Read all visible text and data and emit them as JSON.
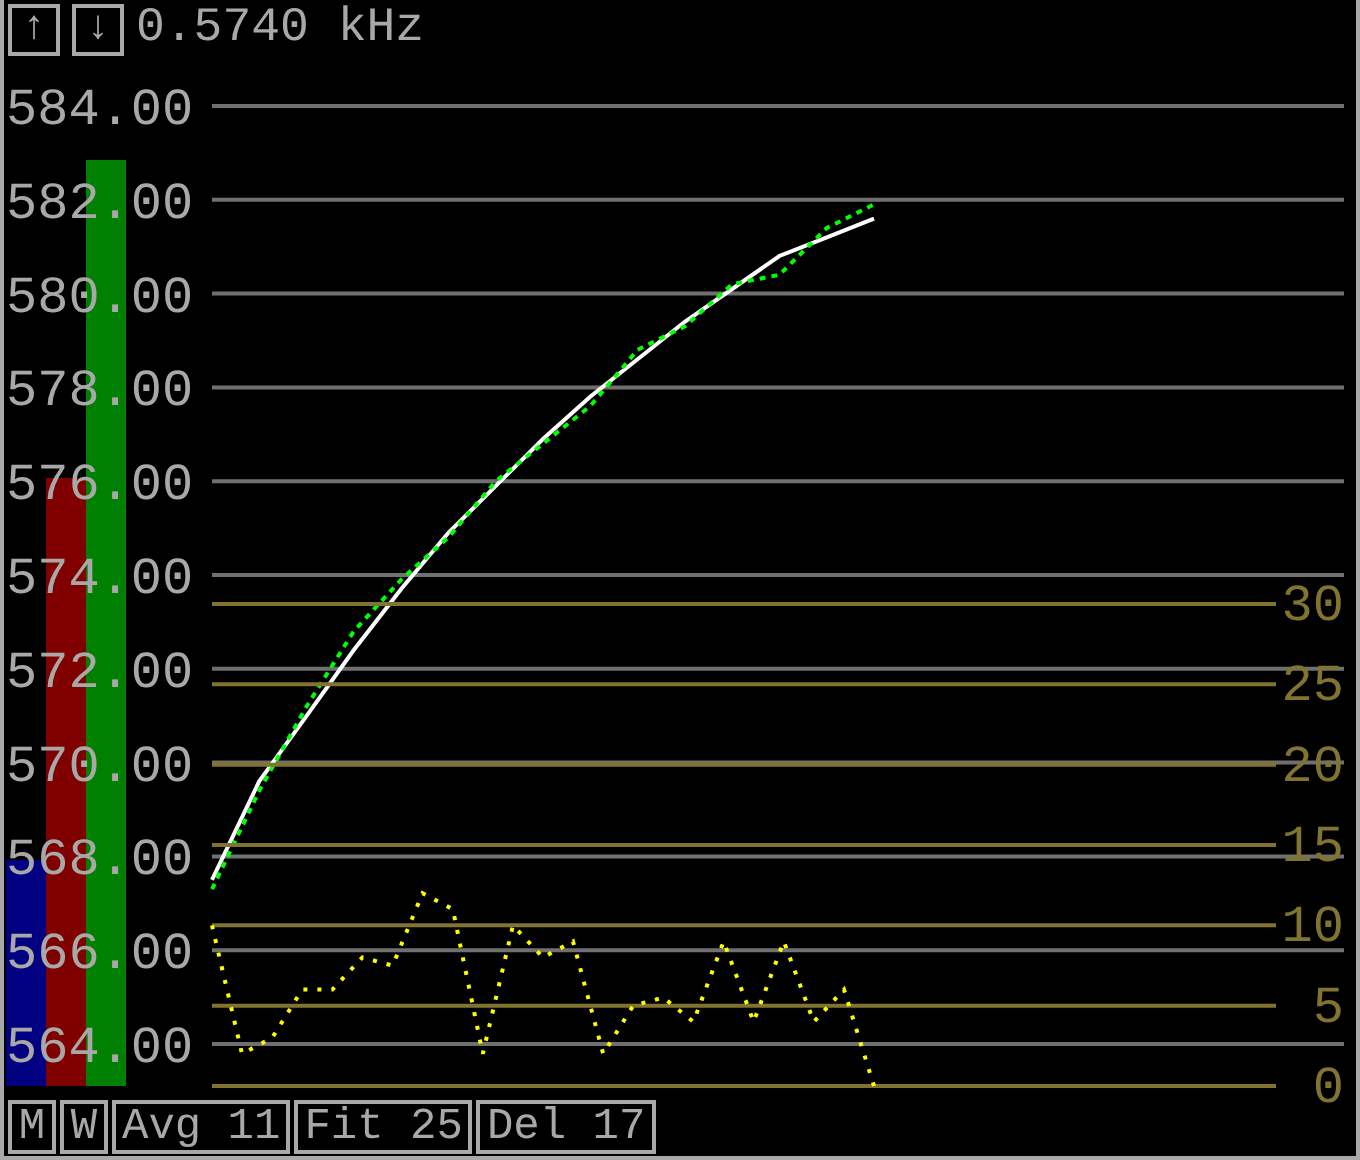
{
  "frequency": {
    "up_label": "↑",
    "down_label": "↓",
    "reading": "0.5740 kHz"
  },
  "meters": [
    {
      "color": "#000080",
      "level": 0.23
    },
    {
      "color": "#800000",
      "level": 0.62
    },
    {
      "color": "#008000",
      "level": 0.945
    }
  ],
  "left_chart": {
    "chart_data": {
      "type": "line",
      "grid": true,
      "ylim": [
        564,
        584
      ],
      "yticks": [
        {
          "value": 584,
          "label": "584.00"
        },
        {
          "value": 582,
          "label": "582.00"
        },
        {
          "value": 580,
          "label": "580.00"
        },
        {
          "value": 578,
          "label": "578.00"
        },
        {
          "value": 576,
          "label": "576.00"
        },
        {
          "value": 574,
          "label": "574.00"
        },
        {
          "value": 572,
          "label": "572.00"
        },
        {
          "value": 570,
          "label": "570.00"
        },
        {
          "value": 568,
          "label": "568.00"
        },
        {
          "value": 566,
          "label": "566.00"
        },
        {
          "value": 564,
          "label": "564.00"
        }
      ],
      "series": [
        {
          "color": "#ffffff",
          "line_style": "solid",
          "values": [
            567.5,
            569.6,
            571.0,
            572.4,
            573.7,
            574.9,
            575.9,
            576.9,
            577.8,
            578.6,
            579.4,
            580.1,
            580.8,
            581.2,
            581.6
          ]
        },
        {
          "color": "#00ff00",
          "line_style": "dashed",
          "values": [
            567.3,
            569.4,
            571.2,
            572.8,
            573.9,
            574.8,
            576.0,
            576.8,
            577.6,
            578.8,
            579.3,
            580.2,
            580.4,
            581.4,
            581.9
          ]
        }
      ]
    }
  },
  "right_chart": {
    "chart_data": {
      "type": "line",
      "grid": true,
      "ylim": [
        0,
        30
      ],
      "yticks": [
        {
          "value": 30,
          "label": "30"
        },
        {
          "value": 25,
          "label": "25"
        },
        {
          "value": 20,
          "label": "20"
        },
        {
          "value": 15,
          "label": "15"
        },
        {
          "value": 10,
          "label": "10"
        },
        {
          "value": 5,
          "label": "5"
        },
        {
          "value": 0,
          "label": "0"
        }
      ],
      "series": [
        {
          "color": "#ffff00",
          "line_style": "dotted",
          "values": [
            10,
            2,
            3,
            6,
            6,
            8,
            7.5,
            12,
            11,
            2,
            10,
            8,
            9,
            2,
            5,
            5.5,
            4,
            9,
            4,
            9,
            4,
            6,
            0
          ]
        }
      ]
    }
  },
  "bottom_bar": [
    {
      "kind": "mode",
      "label": "M"
    },
    {
      "kind": "mode",
      "label": "W"
    },
    {
      "kind": "setting",
      "label": "Avg 11"
    },
    {
      "kind": "setting",
      "label": "Fit 25"
    },
    {
      "kind": "setting",
      "label": "Del 17"
    }
  ]
}
